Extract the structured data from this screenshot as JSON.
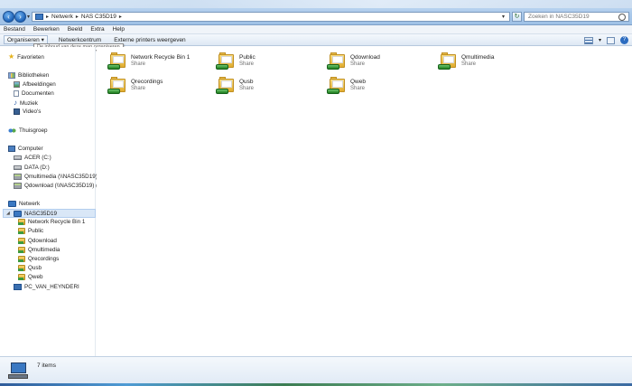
{
  "address": {
    "crumbs": [
      "Netwerk",
      "NAS C35D19"
    ],
    "search_placeholder": "Zoeken in NASC35D19"
  },
  "menu": [
    "Bestand",
    "Bewerken",
    "Beeld",
    "Extra",
    "Help"
  ],
  "toolbar": {
    "organise": "Organiseren",
    "network_center": "Netwerkcentrum",
    "external_printers": "Externe printers weergeven",
    "tooltip": "De inhoud van deze map organiseren"
  },
  "sidebar": {
    "favorites": "Favorieten",
    "libraries": "Bibliotheken",
    "lib_items": [
      "Afbeeldingen",
      "Documenten",
      "Muziek",
      "Video's"
    ],
    "homegroup": "Thuisgroep",
    "computer": "Computer",
    "drives": [
      "ACER (C:)",
      "DATA (D:)",
      "Qmultimedia (\\\\NASC35D19) (Y",
      "Qdownload (\\\\NASC35D19) (Z:)"
    ],
    "network": "Netwerk",
    "nas": "NASC35D19",
    "nas_children": [
      "Network Recycle Bin 1",
      "Public",
      "Qdownload",
      "Qmultimedia",
      "Qrecordings",
      "Qusb",
      "Qweb"
    ],
    "pc": "PC_VAN_HEYNDERI"
  },
  "shares": [
    {
      "name": "Network Recycle Bin 1",
      "type": "Share"
    },
    {
      "name": "Public",
      "type": "Share"
    },
    {
      "name": "Qdownload",
      "type": "Share"
    },
    {
      "name": "Qmultimedia",
      "type": "Share"
    },
    {
      "name": "Qrecordings",
      "type": "Share"
    },
    {
      "name": "Qusb",
      "type": "Share"
    },
    {
      "name": "Qweb",
      "type": "Share"
    }
  ],
  "details": {
    "item_count": "7 items"
  },
  "icons": {
    "nav_back": "back-arrow-icon",
    "nav_forward": "forward-arrow-icon",
    "share": "network-share-icon"
  },
  "colors": {
    "selection": "#d9e7f7",
    "accent": "#3a78c2"
  }
}
